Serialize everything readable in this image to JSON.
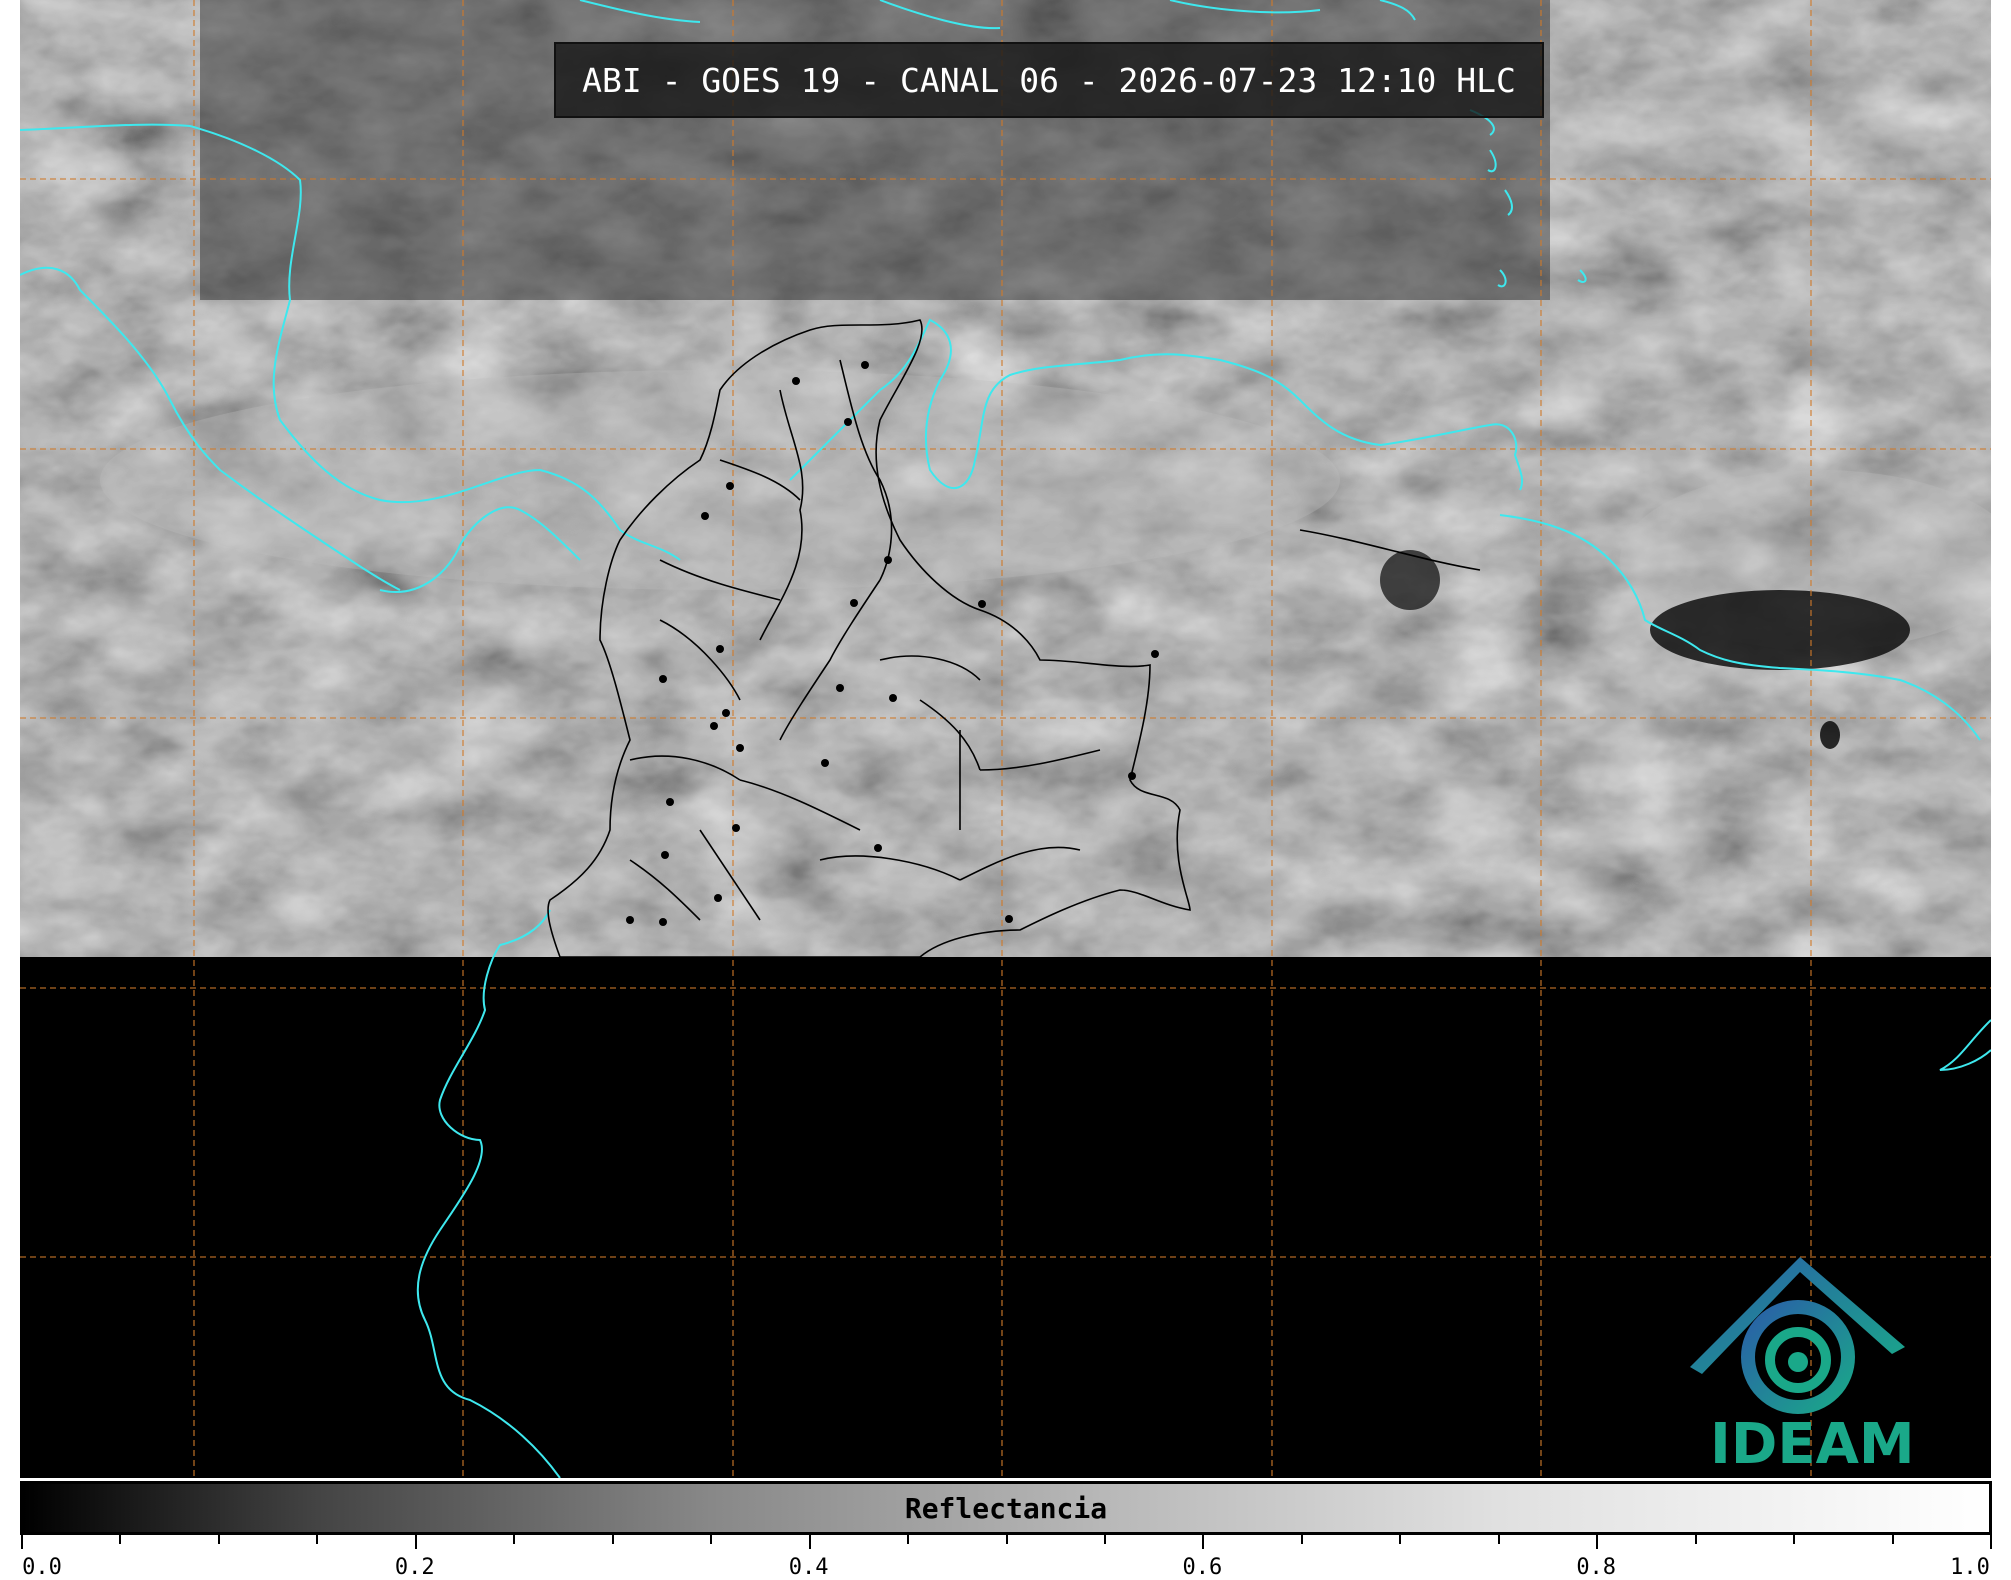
{
  "title": "ABI - GOES 19 - CANAL 06 - 2026-07-23 12:10 HLC",
  "colorbar": {
    "label": "Reflectancia",
    "ticks": [
      "0.0",
      "0.2",
      "0.4",
      "0.6",
      "0.8",
      "1.0"
    ],
    "range": [
      0.0,
      1.0
    ],
    "colors": [
      "#000000",
      "#ffffff"
    ]
  },
  "logo": {
    "text": "IDEAM",
    "colors": [
      "#2a5ea8",
      "#1aa889"
    ]
  },
  "map": {
    "coastline_color": "#3ee8ee",
    "grid_color": "#d07a2a",
    "border_color": "#000000",
    "no_data_color": "#000000"
  }
}
